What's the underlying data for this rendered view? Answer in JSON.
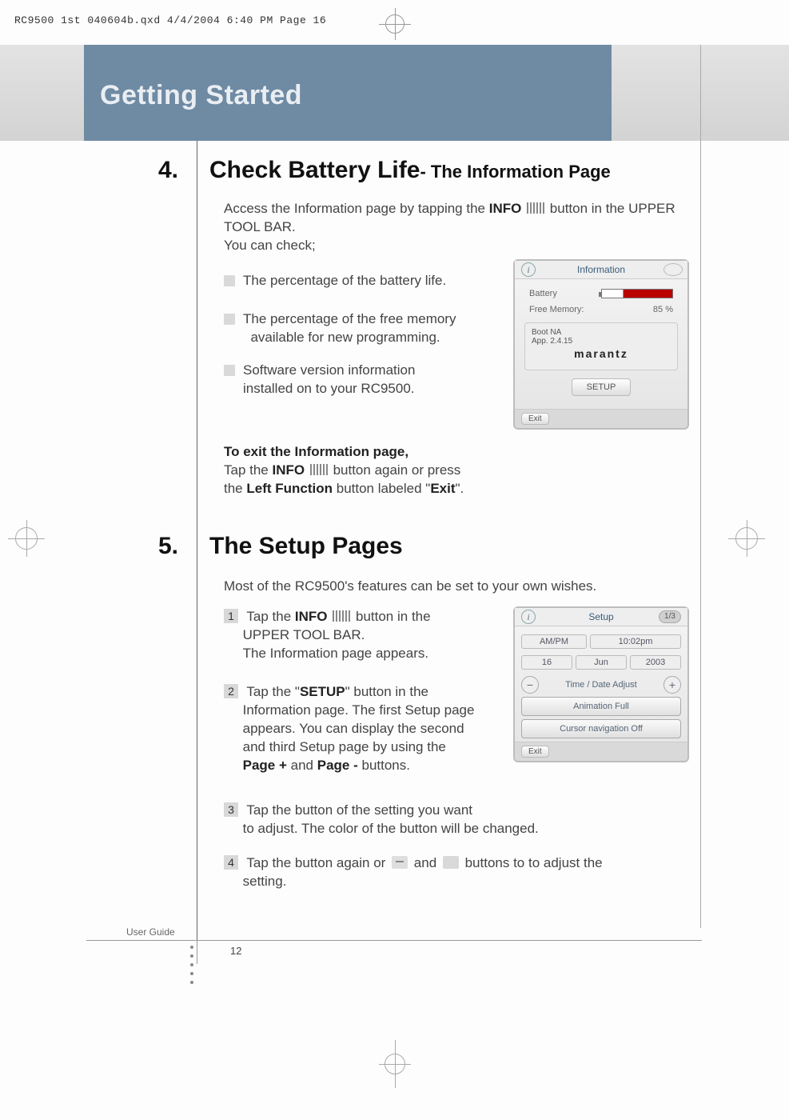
{
  "meta": {
    "file_header": "RC9500 1st 040604b.qxd  4/4/2004  6:40 PM  Page 16"
  },
  "chapter": {
    "title": "Getting Started"
  },
  "section4": {
    "num": "4.",
    "title": "Check Battery Life",
    "subtitle": "- The Information Page",
    "intro_a": "Access the Information page by tapping the ",
    "intro_info": "INFO",
    "intro_b": " button in the UPPER TOOL BAR.",
    "intro_c": "You can check;",
    "b1": "The percentage of the battery life.",
    "b2a": "The percentage of the free memory",
    "b2b": "available for new programming.",
    "b3a": "Software version information",
    "b3b": "installed on to your RC9500.",
    "exit_head": "To exit the Information page,",
    "exit_a": "Tap the ",
    "exit_info": "INFO",
    "exit_b": " button again or press",
    "exit_c": "the ",
    "exit_lf": "Left Function",
    "exit_d": " button labeled \"",
    "exit_e": "Exit",
    "exit_f": "\"."
  },
  "device_info": {
    "title": "Information",
    "battery": "Battery",
    "free_mem_label": "Free Memory:",
    "free_mem_val": "85 %",
    "boot": "Boot NA",
    "app": "App. 2.4.15",
    "brand": "marantz",
    "setup_btn": "SETUP",
    "exit": "Exit"
  },
  "section5": {
    "num": "5.",
    "title": "The Setup Pages",
    "intro": "Most of the RC9500's features can be set to your own wishes.",
    "s1a": "Tap the ",
    "s1_info": "INFO",
    "s1b": " button in the",
    "s1c": "UPPER TOOL BAR.",
    "s1d": "The Information page appears.",
    "s2a": "Tap the \"",
    "s2_setup": "SETUP",
    "s2b": "\" button in the",
    "s2c": "Information page. The first Setup page",
    "s2d": "appears. You can display the second",
    "s2e": "and third Setup page by using the",
    "s2_pp": "Page +",
    "s2_and": " and ",
    "s2_pm": "Page -",
    "s2f": " buttons.",
    "s3a": "Tap the button of the setting you want",
    "s3b": "to adjust. The color of the button will be changed.",
    "s4a": "Tap the button again or ",
    "s4b": " and ",
    "s4c": " buttons to to adjust the",
    "s4d": "setting."
  },
  "device_setup": {
    "title": "Setup",
    "page": "1/3",
    "ampm": "AM/PM",
    "time": "10:02pm",
    "day": "16",
    "month": "Jun",
    "year": "2003",
    "tda": "Time / Date Adjust",
    "anim": "Animation Full",
    "cursor": "Cursor navigation Off",
    "exit": "Exit"
  },
  "footer": {
    "ug": "User Guide",
    "page": "12"
  },
  "dots": "......................................................................................................................"
}
